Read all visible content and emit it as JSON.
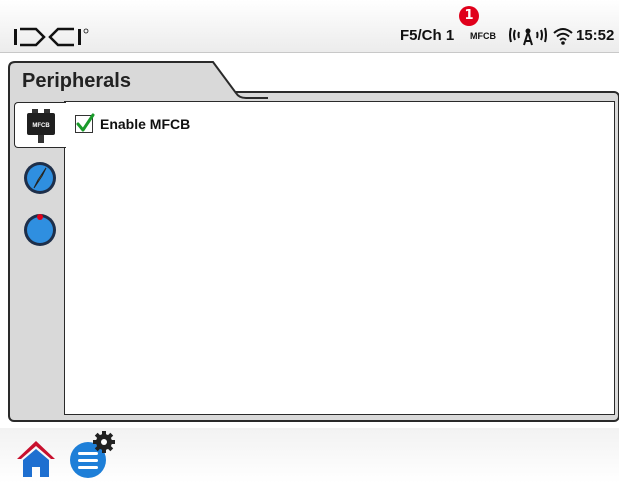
{
  "status_bar": {
    "logo_text": "DCI",
    "frequency": "F5/Ch 1",
    "device_label": "MFCB",
    "notification_count": "1",
    "clock": "15:52",
    "icons": [
      "dci-logo-icon",
      "signal-tower-icon",
      "wifi-icon"
    ]
  },
  "panel": {
    "tab_title": "Peripherals",
    "side_tabs": [
      {
        "name": "mfcb",
        "label": "MFCB",
        "active": true
      },
      {
        "name": "compass",
        "active": false
      },
      {
        "name": "gauge",
        "active": false
      }
    ],
    "option": {
      "label": "Enable MFCB",
      "checked": true
    }
  },
  "bottom_bar": {
    "buttons": [
      "home-icon",
      "settings-menu-icon"
    ]
  },
  "colors": {
    "badge": "#e0001b",
    "accent_blue": "#1e7fd8",
    "check_green": "#1a9a2a"
  }
}
